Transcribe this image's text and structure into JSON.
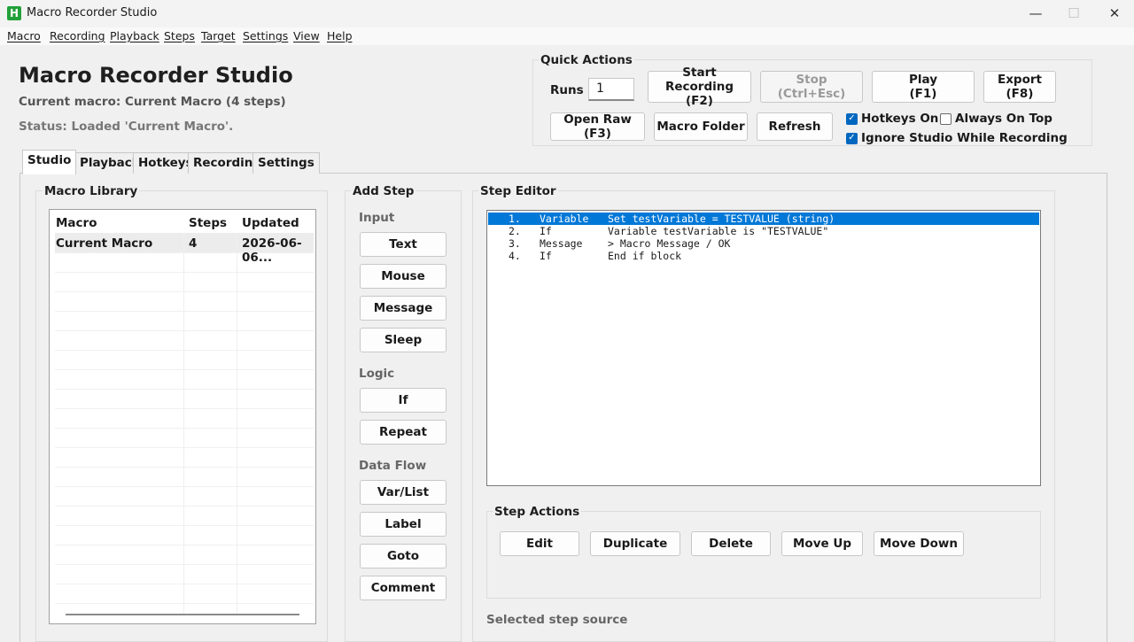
{
  "window": {
    "title": "Macro Recorder Studio",
    "icon_letter": "H",
    "minimize": "—",
    "maximize": "☐",
    "close": "✕"
  },
  "menu": [
    "Macro",
    "Recording",
    "Playback",
    "Steps",
    "Target",
    "Settings",
    "View",
    "Help"
  ],
  "header": {
    "title": "Macro Recorder Studio",
    "current_macro": "Current macro: Current Macro  (4 steps)",
    "status": "Status: Loaded 'Current Macro'."
  },
  "quick_actions": {
    "title": "Quick Actions",
    "runs_label": "Runs",
    "runs_value": "1",
    "start_recording": [
      "Start Recording",
      "(F2)"
    ],
    "stop": [
      "Stop",
      "(Ctrl+Esc)"
    ],
    "play": [
      "Play",
      "(F1)"
    ],
    "export": [
      "Export",
      "(F8)"
    ],
    "open_raw": [
      "Open Raw",
      "(F3)"
    ],
    "macro_folder": "Macro Folder",
    "refresh": "Refresh",
    "hotkeys_on": {
      "label": "Hotkeys On",
      "checked": true
    },
    "always_on_top": {
      "label": "Always On Top",
      "checked": false
    },
    "ignore_studio": {
      "label": "Ignore Studio While Recording",
      "checked": true
    }
  },
  "tabs": [
    "Studio",
    "Playback",
    "Hotkeys",
    "Recording",
    "Settings"
  ],
  "library": {
    "title": "Macro Library",
    "columns": [
      "Macro",
      "Steps",
      "Updated"
    ],
    "rows": [
      [
        "Current Macro",
        "4",
        "2026-06-06..."
      ]
    ]
  },
  "add_step": {
    "title": "Add Step",
    "input_label": "Input",
    "input_buttons": [
      "Text",
      "Mouse",
      "Message",
      "Sleep"
    ],
    "logic_label": "Logic",
    "logic_buttons": [
      "If",
      "Repeat"
    ],
    "dataflow_label": "Data Flow",
    "dataflow_buttons": [
      "Var/List",
      "Label",
      "Goto",
      "Comment"
    ]
  },
  "step_editor": {
    "title": "Step Editor",
    "steps": [
      {
        "num": "1.",
        "type": "Variable",
        "desc": "Set testVariable = TESTVALUE (string)"
      },
      {
        "num": "2.",
        "type": "If",
        "desc": "Variable testVariable is \"TESTVALUE\""
      },
      {
        "num": "3.",
        "type": "Message",
        "desc": "> Macro Message / OK"
      },
      {
        "num": "4.",
        "type": "If",
        "desc": "End if block"
      }
    ],
    "actions_title": "Step Actions",
    "actions": [
      "Edit",
      "Duplicate",
      "Delete",
      "Move Up",
      "Move Down"
    ],
    "selected_source": "Selected step source"
  },
  "colors": {
    "accent": "#0078d7",
    "checkbox": "#0067c0",
    "app_icon": "#22a13a"
  }
}
